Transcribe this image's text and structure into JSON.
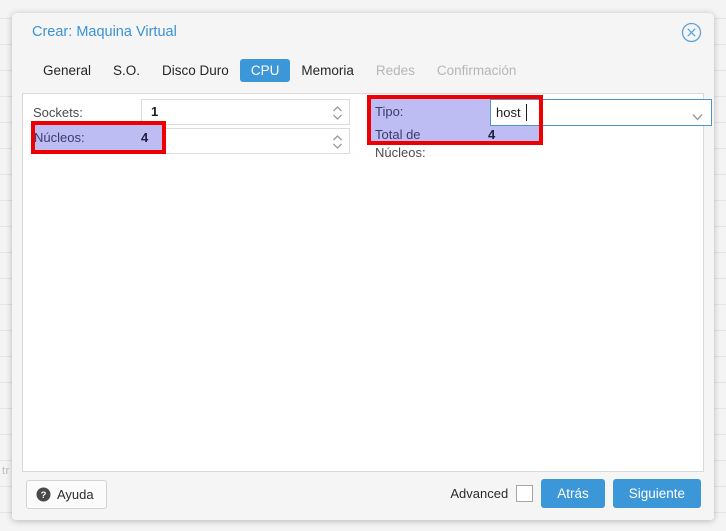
{
  "background": {
    "left_text": "tr"
  },
  "dialog": {
    "title": "Crear: Maquina Virtual",
    "close_icon": "close-circle-icon",
    "tabs": [
      {
        "label": "General",
        "state": "normal"
      },
      {
        "label": "S.O.",
        "state": "normal"
      },
      {
        "label": "Disco Duro",
        "state": "normal"
      },
      {
        "label": "CPU",
        "state": "active"
      },
      {
        "label": "Memoria",
        "state": "normal"
      },
      {
        "label": "Redes",
        "state": "disabled"
      },
      {
        "label": "Confirmación",
        "state": "disabled"
      }
    ]
  },
  "form": {
    "sockets": {
      "label": "Sockets:",
      "value": "1",
      "spinner_icon": "spinner-up-down-icon"
    },
    "nucleos": {
      "label": "Núcleos:",
      "value": "4",
      "spinner_icon": "spinner-up-down-icon",
      "highlighted": true
    },
    "tipo": {
      "label": "Tipo:",
      "value": "host",
      "dropdown_icon": "chevron-down-icon",
      "highlighted": true
    },
    "total_nucleos": {
      "label_line1": "Total de",
      "label_line2": "Núcleos:",
      "value": "4"
    }
  },
  "footer": {
    "help_label": "Ayuda",
    "help_icon": "question-mark-circle-icon",
    "advanced_label": "Advanced",
    "back_label": "Atrás",
    "next_label": "Siguiente"
  },
  "colors": {
    "accent_blue": "#3c97d8",
    "title_blue": "#3a93d6",
    "selection_lavender": "#bdbdf3",
    "annotation_red": "#ee0000",
    "disabled_grey": "#b6b6b6"
  }
}
